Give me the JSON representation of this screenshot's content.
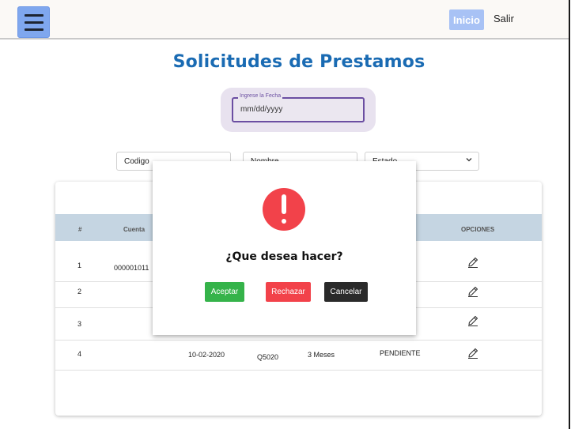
{
  "header": {
    "menu_icon": "hamburger-menu-icon",
    "inicio_label": "Inicio",
    "salir_label": "Salir"
  },
  "page_title": "Solicitudes de Prestamos",
  "date_filter": {
    "label": "Ingrese la Fecha",
    "value": "mm/dd/yyyy"
  },
  "filters": {
    "codigo": "Codigo",
    "nombre": "Nombre",
    "estado": "Estado"
  },
  "table": {
    "headers": [
      "#",
      "Cuenta",
      "OPCIONES"
    ],
    "rows": [
      {
        "num": "1",
        "cuenta": "000001011",
        "fecha": "",
        "codigo": "",
        "plazo": "",
        "estado": ""
      },
      {
        "num": "2",
        "cuenta": "",
        "fecha": "",
        "codigo": "",
        "plazo": "",
        "estado": ""
      },
      {
        "num": "3",
        "cuenta": "",
        "fecha": "",
        "codigo": "",
        "plazo": "",
        "estado": ""
      },
      {
        "num": "4",
        "cuenta": "",
        "fecha": "10-02-2020",
        "codigo": "Q5020",
        "plazo": "3 Meses",
        "estado": "PENDIENTE"
      }
    ],
    "edit_icon": "edit-pencil-icon"
  },
  "modal": {
    "icon": "exclamation-alert-icon",
    "question": "¿Que desea hacer?",
    "accept_label": "Aceptar",
    "reject_label": "Rechazar",
    "cancel_label": "Cancelar"
  },
  "colors": {
    "title": "#1a6bb3",
    "accept": "#35b34a",
    "reject": "#f2424a",
    "cancel": "#2a2a2a",
    "table_header": "#c5d5e2"
  }
}
